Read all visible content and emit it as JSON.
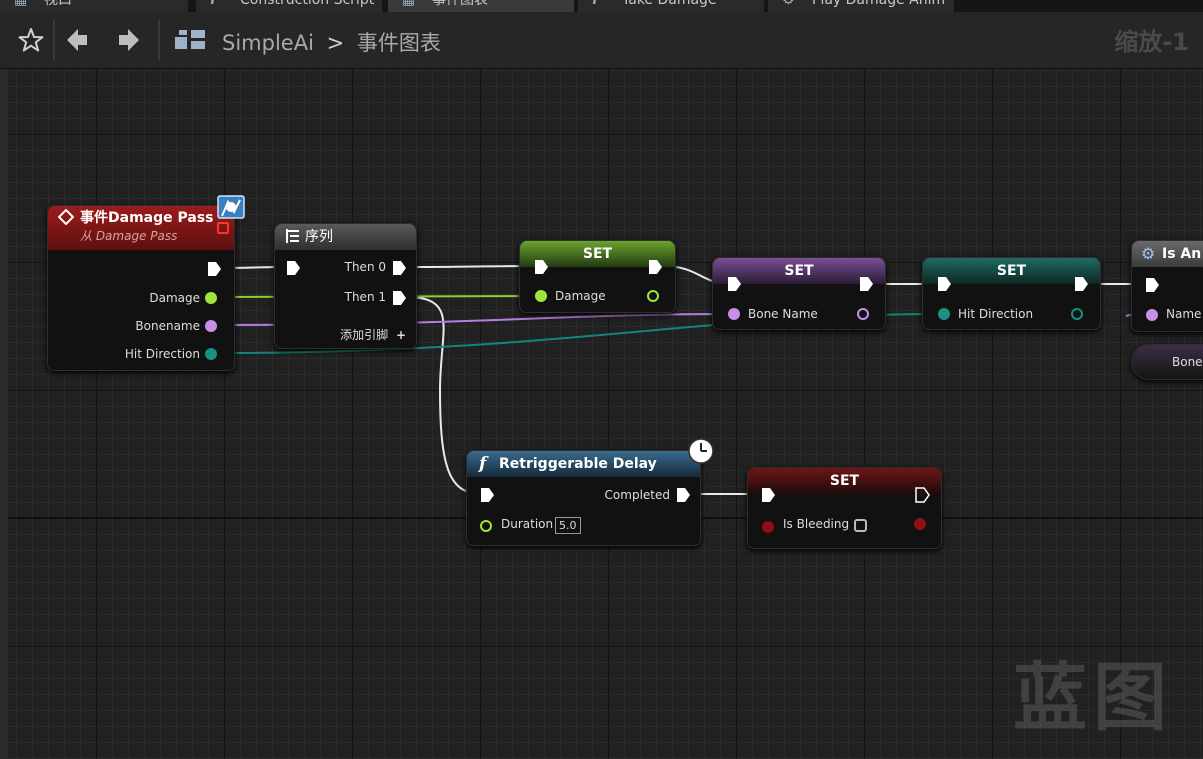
{
  "tabs": [
    {
      "label": "视口",
      "icon": "viewport-icon"
    },
    {
      "label": "Construction Script",
      "icon": "function-icon"
    },
    {
      "label": "事件图表",
      "icon": "graph-icon"
    },
    {
      "label": "Take Damage",
      "icon": "function-icon"
    },
    {
      "label": "Play Damage Anim",
      "icon": "gear-icon"
    }
  ],
  "toolbar": {
    "crumb_root": "SimpleAi",
    "crumb_sep": ">",
    "crumb_current": "事件图表",
    "zoom": "缩放-1"
  },
  "nodes": {
    "event": {
      "title": "事件Damage Pass",
      "subtitle": "从 Damage Pass",
      "pins": [
        "Damage",
        "Bonename",
        "Hit Direction"
      ]
    },
    "sequence": {
      "title": "序列",
      "pins": [
        "Then 0",
        "Then 1"
      ],
      "add_pin": "添加引脚"
    },
    "set_damage": {
      "title": "SET",
      "pin": "Damage"
    },
    "set_bone": {
      "title": "SET",
      "pin": "Bone Name"
    },
    "set_hit": {
      "title": "SET",
      "pin": "Hit Direction"
    },
    "is_anim": {
      "title": "Is An",
      "pin": "Name"
    },
    "bone_getter": {
      "label": "Bone"
    },
    "delay": {
      "title": "Retriggerable Delay",
      "out_pin": "Completed",
      "in_pin": "Duration",
      "duration_value": "5.0"
    },
    "set_bleeding": {
      "title": "SET",
      "pin": "Is Bleeding"
    }
  },
  "colors": {
    "exec": "#ffffff",
    "float_pin": "#9ee53c",
    "name_pin": "#c98ee8",
    "vector_pin": "#1a8f84",
    "bool_pin": "#8e1010",
    "event_header": "#8a1616",
    "delay_header": "#2f5d7c"
  },
  "watermark": "蓝图"
}
